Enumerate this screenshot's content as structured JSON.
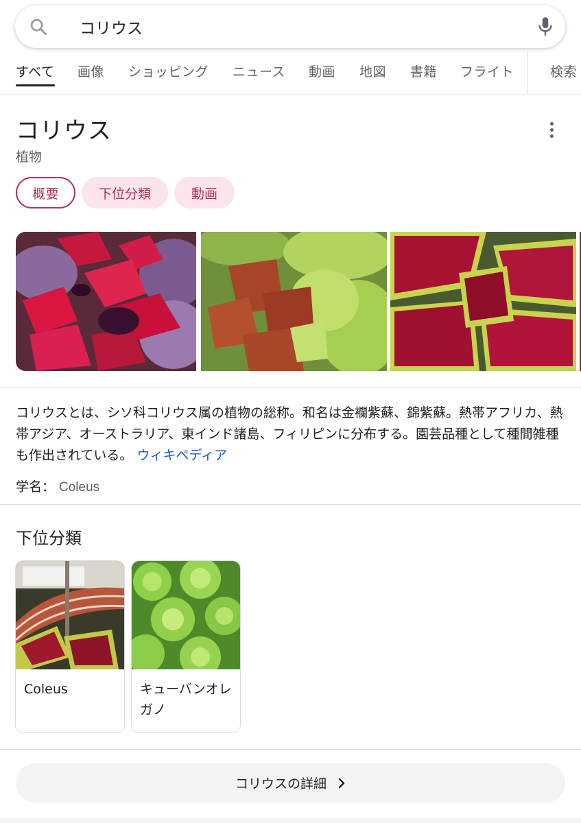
{
  "search": {
    "query": "コリウス"
  },
  "tabs": [
    {
      "label": "すべて",
      "active": true
    },
    {
      "label": "画像"
    },
    {
      "label": "ショッピング"
    },
    {
      "label": "ニュース"
    },
    {
      "label": "動画"
    },
    {
      "label": "地図"
    },
    {
      "label": "書籍"
    },
    {
      "label": "フライト"
    },
    {
      "label": "検索"
    }
  ],
  "panel": {
    "title": "コリウス",
    "subtitle": "植物",
    "chips": [
      {
        "label": "概要",
        "active": true
      },
      {
        "label": "下位分類"
      },
      {
        "label": "動画"
      }
    ],
    "images": [
      "coleus-red-purple",
      "coleus-green-brown",
      "coleus-red-lime-edge"
    ],
    "description": "コリウスとは、シソ科コリウス属の植物の総称。和名は金襴紫蘇、錦紫蘇。熱帯アフリカ、熱帯アジア、オーストラリア、東インド諸島、フィリピンに分布する。園芸品種として種間雑種も作出されている。",
    "description_link": "ウィキペディア",
    "scientific_name_label": "学名：",
    "scientific_name_value": "Coleus"
  },
  "subclass": {
    "heading": "下位分類",
    "cards": [
      {
        "label": "Coleus"
      },
      {
        "label": "キューバンオレガノ"
      }
    ]
  },
  "more_button": {
    "label": "コリウスの詳細"
  },
  "colors": {
    "chip_bg": "#fbe4ea",
    "chip_text": "#b0305a",
    "link": "#1558d6"
  }
}
